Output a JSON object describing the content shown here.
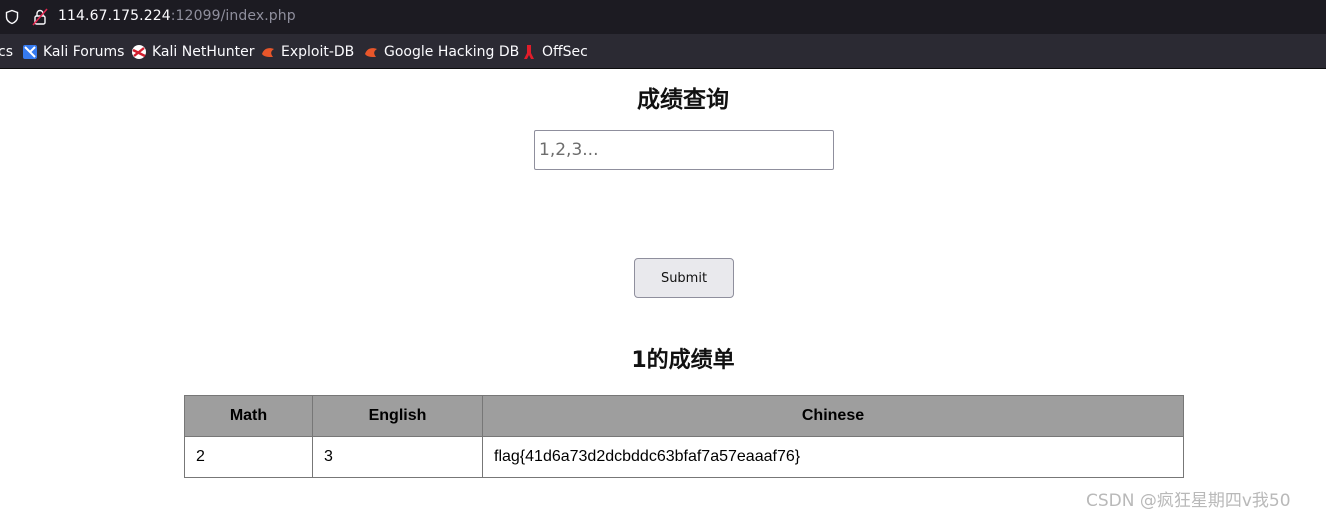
{
  "browser": {
    "url_host": "114.67.175.224",
    "url_rest": ":12099/index.php",
    "bookmarks": [
      {
        "label": "cs"
      },
      {
        "label": "Kali Forums"
      },
      {
        "label": "Kali NetHunter"
      },
      {
        "label": "Exploit-DB"
      },
      {
        "label": "Google Hacking DB"
      },
      {
        "label": "OffSec"
      }
    ]
  },
  "page": {
    "title": "成绩查询",
    "query_placeholder": "1,2,3...",
    "query_value": "",
    "submit_label": "Submit",
    "result_heading": "1的成绩单",
    "table": {
      "headers": [
        "Math",
        "English",
        "Chinese"
      ],
      "rows": [
        [
          "2",
          "3",
          "flag{41d6a73d2dcbddc63bfaf7a57eaaaf76}"
        ]
      ]
    }
  },
  "watermark": "CSDN @疯狂星期四v我50",
  "colors": {
    "urlbar_bg": "#1c1b22",
    "bookmarks_bg": "#2b2a33",
    "table_header_bg": "#9e9e9e"
  }
}
